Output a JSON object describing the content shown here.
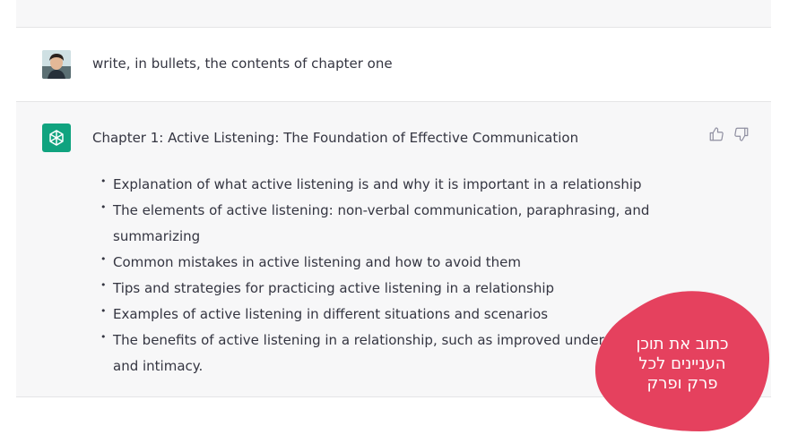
{
  "conversation": {
    "user_message": "write, in bullets, the contents of chapter one",
    "assistant": {
      "title": "Chapter 1: Active Listening: The Foundation of Effective Communication",
      "bullets": [
        "Explanation of what active listening is and why it is important in a relationship",
        "The elements of active listening: non-verbal communication, paraphrasing, and summarizing",
        "Common mistakes in active listening and how to avoid them",
        "Tips and strategies for practicing active listening in a relationship",
        "Examples of active listening in different situations and scenarios",
        "The benefits of active listening in a relationship, such as improved understanding and intimacy."
      ]
    }
  },
  "overlay": {
    "lines": [
      "כתוב את תוכן",
      "העניינים לכל",
      "פרק ופרק"
    ],
    "color": "#e5415e"
  },
  "icons": {
    "assistant_avatar": "openai-logo-icon",
    "thumbs_up": "thumbs-up-icon",
    "thumbs_down": "thumbs-down-icon"
  },
  "colors": {
    "assistant_row_bg": "#f7f7f8",
    "assistant_avatar_bg": "#10a37f",
    "text": "#343541"
  }
}
